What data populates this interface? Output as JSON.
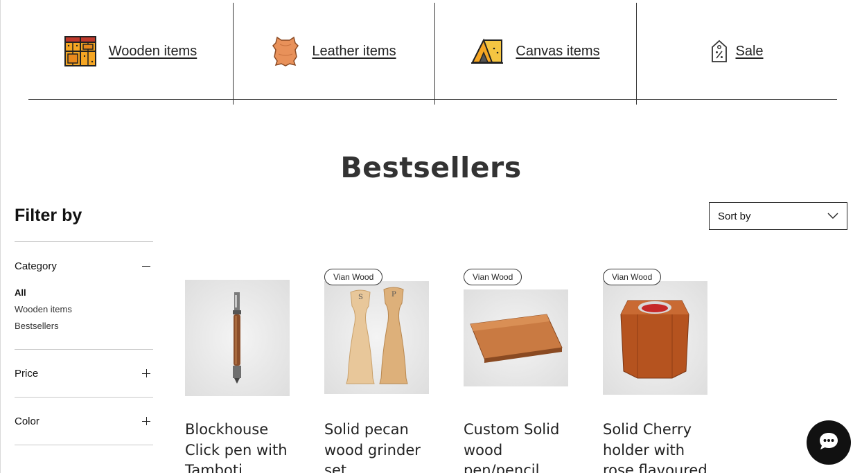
{
  "category_nav": [
    {
      "label": "Wooden items",
      "icon": "wooden-crate-icon"
    },
    {
      "label": "Leather items",
      "icon": "leather-hide-icon"
    },
    {
      "label": "Canvas items",
      "icon": "tent-icon"
    },
    {
      "label": "Sale",
      "icon": "sale-tag-icon"
    }
  ],
  "heading": "Bestsellers",
  "filter": {
    "title": "Filter by",
    "category_label": "Category",
    "category_options": [
      "All",
      "Wooden items",
      "Bestsellers"
    ],
    "selected_category": "All",
    "price_label": "Price",
    "color_label": "Color"
  },
  "sort": {
    "label": "Sort by"
  },
  "products": [
    {
      "title": "Blockhouse Click pen with Tamboti",
      "badge": ""
    },
    {
      "title": "Solid pecan wood grinder set",
      "badge": "Vian Wood"
    },
    {
      "title": "Custom Solid wood pen/pencil",
      "badge": "Vian Wood"
    },
    {
      "title": "Solid Cherry holder with rose flavoured",
      "badge": "Vian Wood"
    }
  ],
  "colors": {
    "text": "#1a1a1a",
    "icon_orange": "#f5a623",
    "chat_bg": "#111111"
  },
  "chat": {
    "icon": "chat-bubble-icon"
  }
}
